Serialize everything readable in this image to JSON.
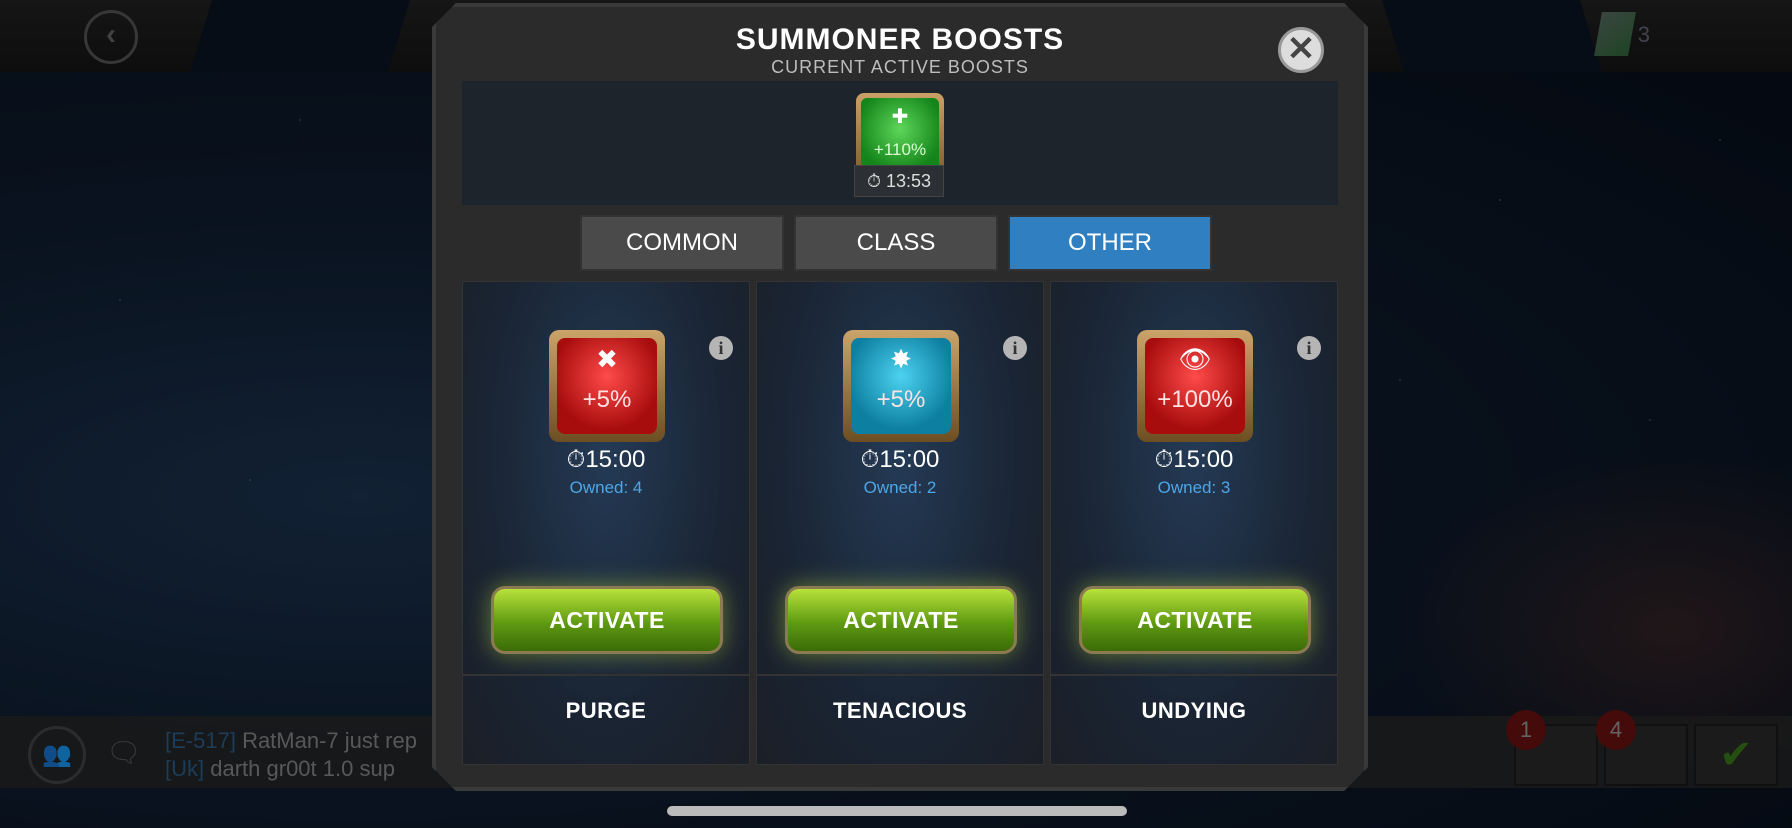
{
  "header": {
    "back_icon": "chevron-left-icon",
    "unit_count": "3"
  },
  "modal": {
    "title": "SUMMONER BOOSTS",
    "subtitle": "CURRENT ACTIVE BOOSTS",
    "close_icon": "close-icon",
    "active_boost": {
      "percent": "+110%",
      "timer": "13:53",
      "color": "#14851a"
    },
    "tabs": [
      {
        "label": "COMMON"
      },
      {
        "label": "CLASS"
      },
      {
        "label": "OTHER"
      }
    ],
    "selected_tab": "OTHER",
    "boosts": [
      {
        "name": "PURGE",
        "percent": "+5%",
        "timer": "15:00",
        "owned": "Owned: 4",
        "button": "ACTIVATE",
        "color": "#a80d0d"
      },
      {
        "name": "TENACIOUS",
        "percent": "+5%",
        "timer": "15:00",
        "owned": "Owned: 2",
        "button": "ACTIVATE",
        "color": "#0d7fa0"
      },
      {
        "name": "UNDYING",
        "percent": "+100%",
        "timer": "15:00",
        "owned": "Owned: 3",
        "button": "ACTIVATE",
        "color": "#a80d0d"
      }
    ]
  },
  "chat": {
    "lines": [
      {
        "tag": "[E-517]",
        "user": "RatMan-7",
        "text": "just rep"
      },
      {
        "tag": "[Uk]",
        "user": "darth gr00t 1.0",
        "text": "sup"
      }
    ]
  },
  "bottom_buttons": {
    "quests_badge": "1",
    "tasks_badge": "4"
  },
  "colors": {
    "accent_tab": "#2f7fc1",
    "activate_green": "#5f9a12",
    "owned_text": "#4ea6e6"
  }
}
